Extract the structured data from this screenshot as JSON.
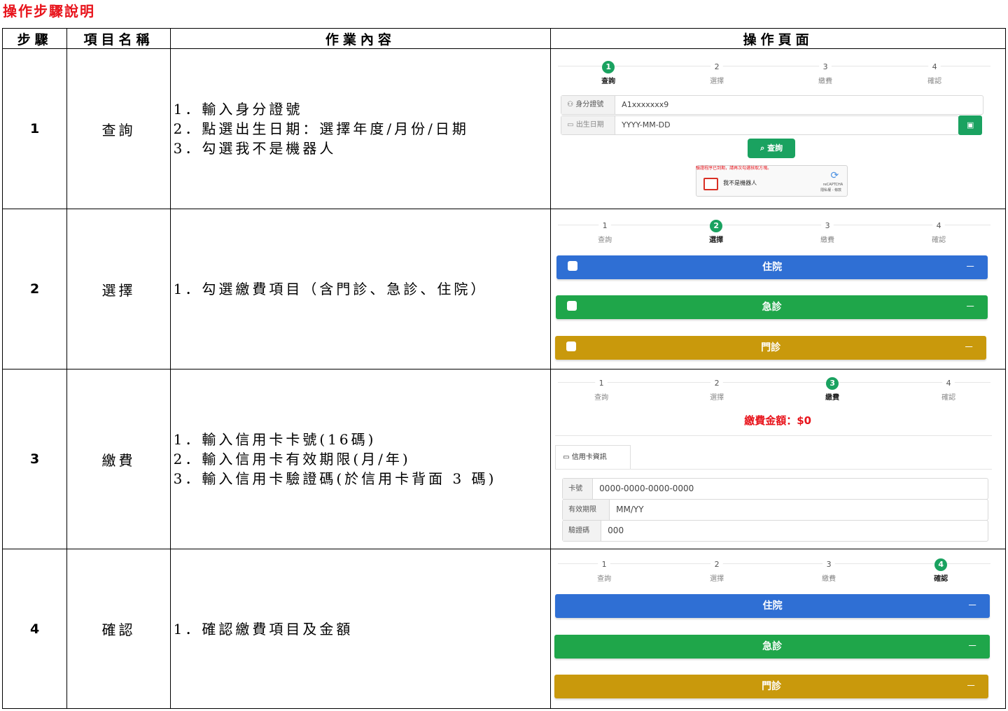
{
  "page_title": "操作步驟說明",
  "headers": [
    "步驟",
    "項目名稱",
    "作業內容",
    "操作頁面"
  ],
  "colors": {
    "green": "#1aa260",
    "blue": "#2f6fd4",
    "bar_green": "#1fa64a",
    "gold": "#c9990c",
    "red": "#e8131b"
  },
  "steps_labels": [
    {
      "num": "1",
      "label": "查詢"
    },
    {
      "num": "2",
      "label": "選擇"
    },
    {
      "num": "3",
      "label": "繳費"
    },
    {
      "num": "4",
      "label": "確認"
    }
  ],
  "rows": [
    {
      "step": "1",
      "name": "查詢",
      "content": [
        "1．輸入身分證號",
        "2．點選出生日期：選擇年度/月份/日期",
        "3．勾選我不是機器人"
      ]
    },
    {
      "step": "2",
      "name": "選擇",
      "content": [
        "1．勾選繳費項目（含門診、急診、住院）"
      ]
    },
    {
      "step": "3",
      "name": "繳費",
      "content": [
        "1．輸入信用卡卡號(16碼)",
        "2．輸入信用卡有效期限(月/年)",
        "3．輸入信用卡驗證碼(於信用卡背面 3 碼)"
      ]
    },
    {
      "step": "4",
      "name": "確認",
      "content": [
        "1．確認繳費項目及金額"
      ]
    }
  ],
  "query_form": {
    "id_label": "身分證號",
    "id_value": "A1xxxxxxx9",
    "dob_label": "出生日期",
    "dob_placeholder": "YYYY-MM-DD",
    "query_button": "查詢",
    "captcha_error": "驗證程序已到期，請再次勾選核取方塊。",
    "captcha_label": "我不是機器人",
    "captcha_brand": "reCAPTCHA",
    "captcha_links": "隱私權 - 條款"
  },
  "items": {
    "inpatient": "住院",
    "emergency": "急診",
    "outpatient": "門診",
    "collapse": "－"
  },
  "payment": {
    "amount_text": "繳費金額：$0",
    "tab_label": "信用卡資訊",
    "card_label": "卡號",
    "card_placeholder": "0000-0000-0000-0000",
    "exp_label": "有效期限",
    "exp_placeholder": "MM/YY",
    "cvv_label": "驗證碼",
    "cvv_placeholder": "000"
  }
}
